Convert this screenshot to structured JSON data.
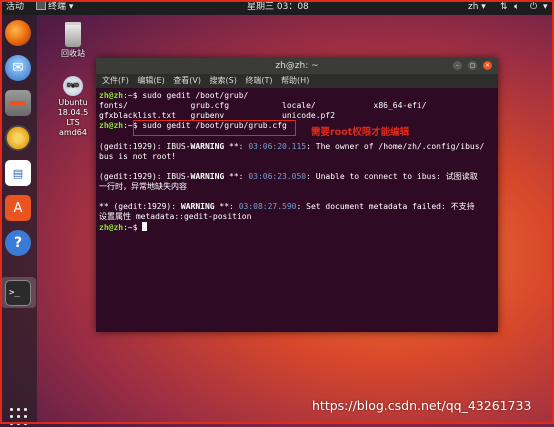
{
  "topbar": {
    "activities": "活动",
    "app_menu": "终端",
    "clock": "星期三 03：08",
    "user": "zh"
  },
  "desktop": {
    "trash_label": "回收站",
    "dvd_label_1": "Ubuntu",
    "dvd_label_2": "18.04.5 LTS",
    "dvd_label_3": "amd64"
  },
  "dock": {
    "items": [
      "firefox-icon",
      "thunderbird-icon",
      "files-icon",
      "rhythmbox-icon",
      "writer-icon",
      "software-icon",
      "help-icon",
      "terminal-icon"
    ]
  },
  "terminal": {
    "title": "zh@zh: ~",
    "menu": [
      "文件(F)",
      "编辑(E)",
      "查看(V)",
      "搜索(S)",
      "终端(T)",
      "帮助(H)"
    ],
    "prompt": "zh@zh",
    "prompt_sep": ":~$",
    "lines": {
      "cmd1": " sudo gedit /boot/grub/",
      "ls1": "fonts/             grub.cfg           locale/            x86_64-efi/",
      "ls2": "gfxblacklist.txt   grubenv            unicode.pf2",
      "cmd2": " sudo gedit /boot/grub/grub.cfg",
      "e1_pre": "(gedit:1929): IBUS-",
      "e1_warn": "WARNING",
      "e1_mid": " **: ",
      "e1_ts": "03:06:20.115",
      "e1_msg": ": The owner of /home/zh/.config/ibus/",
      "e1_cont": "bus is not root!",
      "e2_pre": "(gedit:1929): IBUS-",
      "e2_warn": "WARNING",
      "e2_mid": " **: ",
      "e2_ts": "03:06:23.050",
      "e2_msg": ": Unable to connect to ibus: 试图读取",
      "e2_cont": "一行时，异常地缺失内容",
      "e3_pre": "** (gedit:1929): ",
      "e3_warn": "WARNING",
      "e3_mid": " **: ",
      "e3_ts": "03:08:27.590",
      "e3_msg": ": Set document metadata failed: 不支持",
      "e3_cont": "设置属性 metadata::gedit-position"
    }
  },
  "annotation": "需要root权限才能编辑",
  "watermark": "https://blog.csdn.net/qq_43261733",
  "colors": {
    "accent": "#e95420",
    "annotation_red": "#e02a1a",
    "terminal_bg": "#2f0a24",
    "prompt_green": "#8ae234",
    "timestamp_blue": "#729fcf"
  }
}
